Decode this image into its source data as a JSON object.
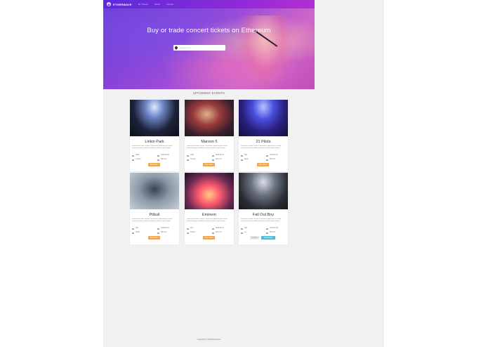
{
  "nav": {
    "brand": "ETHERWAVE",
    "links": [
      "My Tickets",
      "About",
      "Contact"
    ]
  },
  "hero": {
    "title": "Buy or trade concert tickets on Ethereum",
    "search_placeholder": "Location, etc..."
  },
  "section_title": "UPCOMING EVENTS",
  "cards": [
    {
      "title": "Linkin Park",
      "desc": "Lorem ipsum dolor sit amet, consectetur adipiscing elit, sed do eiusmod tempor incididunt ut labore et dolore magna aliqua.",
      "left1": "2000",
      "right1": "2018-01-06",
      "left2": "London",
      "right2": "300 LKT",
      "buttons": [
        "Buy Ticket"
      ]
    },
    {
      "title": "Maroon 5",
      "desc": "Lorem ipsum dolor sit amet, consectetur adipiscing elit, sed do eiusmod tempor incididunt ut labore et dolore magna aliqua.",
      "left1": "1000",
      "right1": "2018-02-03",
      "left2": "Toronto",
      "right2": "300 LKT",
      "buttons": [
        "Buy Ticket"
      ]
    },
    {
      "title": "21 Pilots",
      "desc": "Lorem ipsum dolor sit amet, consectetur adipiscing elit, sed do eiusmod tempor incididunt ut labore et dolore magna aliqua.",
      "left1": "500",
      "right1": "2018-03-10",
      "left2": "Berlin",
      "right2": "400 LKT",
      "buttons": [
        "Buy Ticket"
      ]
    },
    {
      "title": "Pitbull",
      "desc": "Lorem ipsum dolor sit amet, consectetur adipiscing elit, sed do eiusmod tempor incididunt ut labore et dolore magna aliqua.",
      "left1": "500",
      "right1": "2018-04-01",
      "left2": "Miami",
      "right2": "200 LKT",
      "buttons": [
        "Buy Ticket"
      ]
    },
    {
      "title": "Eminem",
      "desc": "Lorem ipsum dolor sit amet, consectetur adipiscing elit, sed do eiusmod tempor incididunt ut labore et dolore magna aliqua.",
      "left1": "250",
      "right1": "2018-05-12",
      "left2": "Detroit",
      "right2": "300 LKT",
      "buttons": [
        "Buy Ticket"
      ]
    },
    {
      "title": "Fall Out Boy",
      "desc": "Lorem ipsum dolor sit amet, consectetur adipiscing elit, sed do eiusmod tempor incididunt ut labore et dolore magna aliqua.",
      "left1": "300",
      "right1": "2018-06-08",
      "left2": "LA",
      "right2": "300 LKT",
      "buttons": [
        "Sold Out",
        "Trade Ticket"
      ]
    }
  ],
  "footer": "Copyright © 2018 Etherwave"
}
